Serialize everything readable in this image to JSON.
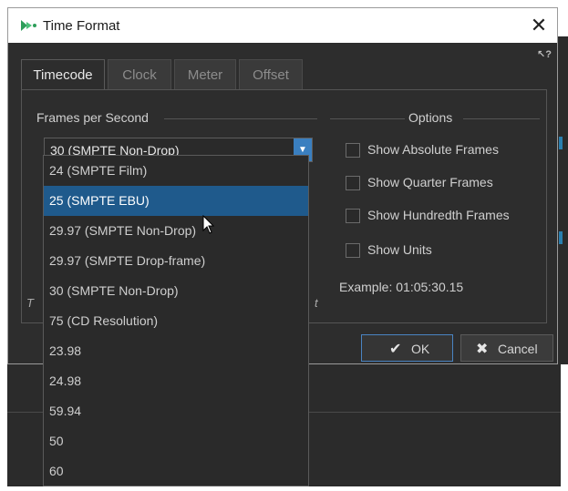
{
  "window": {
    "title": "Time Format",
    "close_glyph": "✕",
    "help_glyph": "↖?"
  },
  "tabs": [
    {
      "label": "Timecode",
      "active": true
    },
    {
      "label": "Clock",
      "active": false
    },
    {
      "label": "Meter",
      "active": false
    },
    {
      "label": "Offset",
      "active": false
    }
  ],
  "fps": {
    "section_label": "Frames per Second",
    "selected_value": "30 (SMPTE Non-Drop)",
    "arrow_glyph": "▼"
  },
  "options": {
    "section_label": "Options",
    "checkboxes": [
      {
        "label": "Show Absolute Frames",
        "checked": false
      },
      {
        "label": "Show Quarter Frames",
        "checked": false
      },
      {
        "label": "Show Hundredth Frames",
        "checked": false
      },
      {
        "label": "Show Units",
        "checked": false
      }
    ],
    "example": "Example: 01:05:30.15"
  },
  "partial_text": {
    "left": "T",
    "right": "t"
  },
  "buttons": {
    "ok_icon": "✔",
    "ok_label": "OK",
    "cancel_icon": "✖",
    "cancel_label": "Cancel"
  },
  "dropdown": {
    "items": [
      {
        "label": "24 (SMPTE Film)",
        "selected": false
      },
      {
        "label": "25 (SMPTE EBU)",
        "selected": true
      },
      {
        "label": "29.97 (SMPTE Non-Drop)",
        "selected": false
      },
      {
        "label": "29.97 (SMPTE Drop-frame)",
        "selected": false
      },
      {
        "label": "30 (SMPTE Non-Drop)",
        "selected": false
      },
      {
        "label": "75 (CD Resolution)",
        "selected": false
      },
      {
        "label": "23.98",
        "selected": false
      },
      {
        "label": "24.98",
        "selected": false
      },
      {
        "label": "59.94",
        "selected": false
      },
      {
        "label": "50",
        "selected": false
      },
      {
        "label": "60",
        "selected": false
      }
    ]
  },
  "colors": {
    "accent": "#3a7fc0",
    "selection": "#1f5a8c",
    "dialog_bg": "#2d2d2d"
  }
}
